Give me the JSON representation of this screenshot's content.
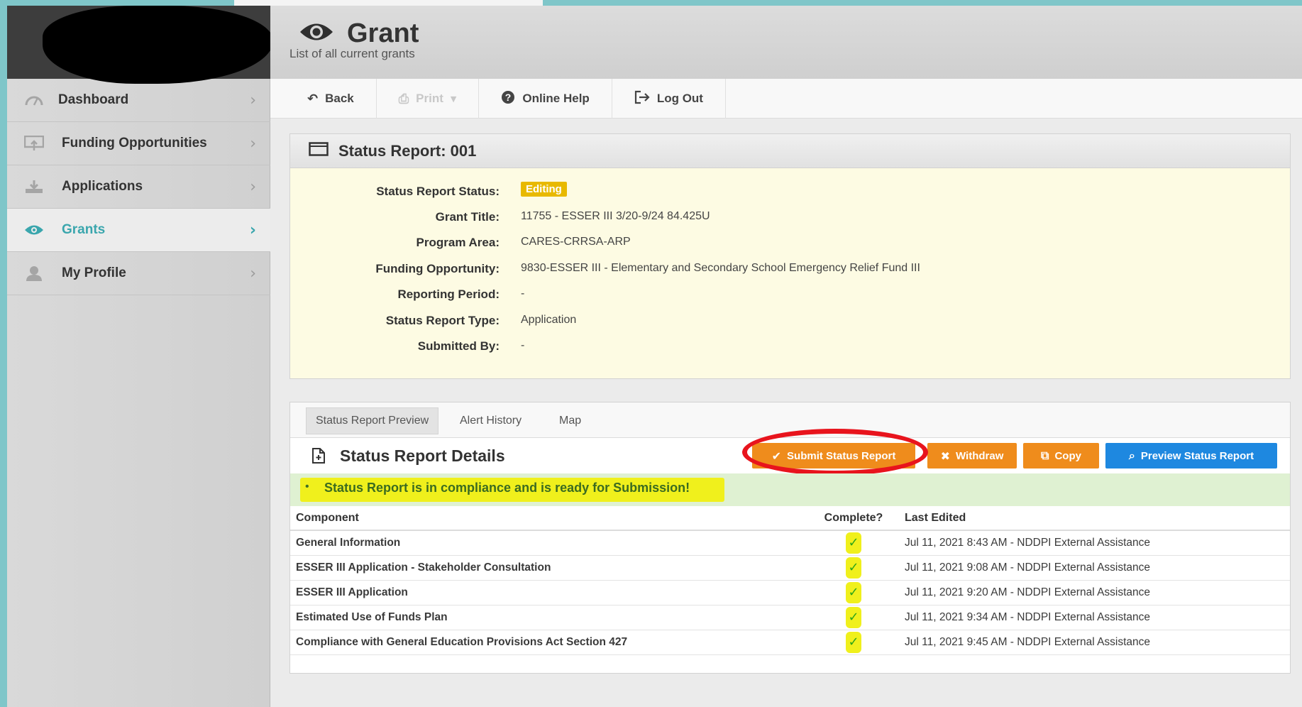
{
  "header": {
    "title": "Grant",
    "subtitle": "List of all current grants"
  },
  "sidebar": {
    "items": [
      {
        "label": "Dashboard",
        "icon": "dashboard-icon",
        "active": false
      },
      {
        "label": "Funding Opportunities",
        "icon": "funding-icon",
        "active": false
      },
      {
        "label": "Applications",
        "icon": "download-icon",
        "active": false
      },
      {
        "label": "Grants",
        "icon": "eye-icon",
        "active": true
      },
      {
        "label": "My Profile",
        "icon": "user-icon",
        "active": false
      }
    ]
  },
  "toolbar": {
    "back": "Back",
    "print": "Print",
    "help": "Online Help",
    "logout": "Log Out"
  },
  "status_report": {
    "title": "Status Report: 001",
    "fields": [
      {
        "label": "Status Report Status:",
        "value": "Editing",
        "badge": true
      },
      {
        "label": "Grant Title:",
        "value": "11755 - ESSER III 3/20-9/24 84.425U"
      },
      {
        "label": "Program Area:",
        "value": "CARES-CRRSA-ARP"
      },
      {
        "label": "Funding Opportunity:",
        "value": "9830-ESSER III - Elementary and Secondary School Emergency Relief Fund III"
      },
      {
        "label": "Reporting Period:",
        "value": "-"
      },
      {
        "label": "Status Report Type:",
        "value": "Application"
      },
      {
        "label": "Submitted By:",
        "value": "-"
      }
    ]
  },
  "tabs": [
    "Status Report Preview",
    "Alert History",
    "Map"
  ],
  "details": {
    "title": "Status Report Details",
    "buttons": {
      "submit": "Submit Status Report",
      "withdraw": "Withdraw",
      "copy": "Copy",
      "preview": "Preview Status Report"
    },
    "alert": "Status Report is in compliance and is ready for Submission!",
    "columns": [
      "Component",
      "Complete?",
      "Last Edited"
    ],
    "rows": [
      {
        "component": "General Information",
        "complete": true,
        "last_edited": "Jul 11, 2021 8:43 AM - NDDPI External Assistance"
      },
      {
        "component": "ESSER III Application - Stakeholder Consultation",
        "complete": true,
        "last_edited": "Jul 11, 2021 9:08 AM - NDDPI External Assistance"
      },
      {
        "component": "ESSER III Application",
        "complete": true,
        "last_edited": "Jul 11, 2021 9:20 AM - NDDPI External Assistance"
      },
      {
        "component": "Estimated Use of Funds Plan",
        "complete": true,
        "last_edited": "Jul 11, 2021 9:34 AM - NDDPI External Assistance"
      },
      {
        "component": "Compliance with General Education Provisions Act Section 427",
        "complete": true,
        "last_edited": "Jul 11, 2021 9:45 AM - NDDPI External Assistance"
      }
    ]
  },
  "colors": {
    "accent": "#3aa6ad",
    "badge": "#e8b900",
    "orange_button": "#ef8c1c",
    "blue_button": "#1e88e0",
    "highlight": "#f0f01c",
    "annotation_ring": "#e8141d"
  }
}
